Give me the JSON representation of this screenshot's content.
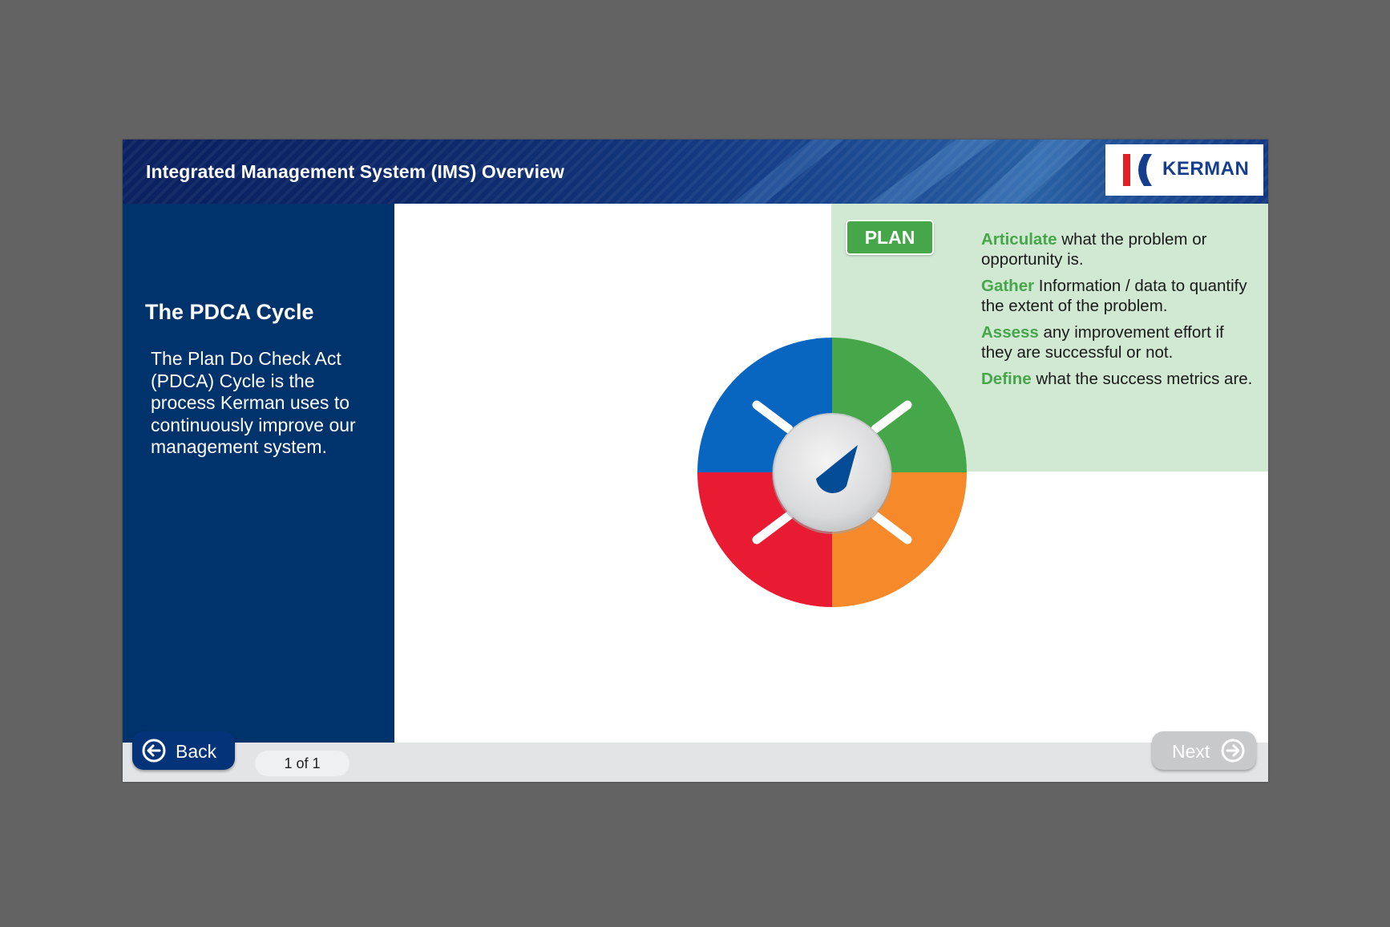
{
  "header": {
    "title": "Integrated Management System (IMS) Overview"
  },
  "logo": {
    "text": "KERMAN"
  },
  "sidebar": {
    "title": "The PDCA Cycle",
    "body": "The Plan Do Check Act (PDCA) Cycle is the process Kerman uses to continuously improve our management system."
  },
  "plan": {
    "badge": "PLAN",
    "items": [
      {
        "keyword": "Articulate",
        "text": " what the problem or opportunity is."
      },
      {
        "keyword": "Gather",
        "text": " Information / data to quantify the extent of the problem."
      },
      {
        "keyword": "Assess",
        "text": " any improvement effort if they are successful or not."
      },
      {
        "keyword": "Define",
        "text": " what the success metrics are."
      }
    ]
  },
  "wheel": {
    "quadrants": [
      "plan",
      "do",
      "check",
      "act"
    ],
    "colors": {
      "plan": "#46a64a",
      "do": "#f68a2a",
      "check": "#e91b32",
      "act": "#0866c1",
      "dial": "#dfe0e1",
      "needle": "#054c96"
    }
  },
  "footer": {
    "back_label": "Back",
    "next_label": "Next",
    "page_counter": "1 of 1"
  },
  "colors": {
    "background": "#636363",
    "header": "#0a2262",
    "sidebar": "#00326b",
    "plan_panel": "#d1e8d3",
    "accent_green": "#46a64a",
    "back_button": "#04337a",
    "next_button_disabled": "#c8c9cb"
  },
  "icons": [
    "back-arrow-icon",
    "next-arrow-icon",
    "kerman-logo-mark",
    "dial-needle-icon"
  ]
}
